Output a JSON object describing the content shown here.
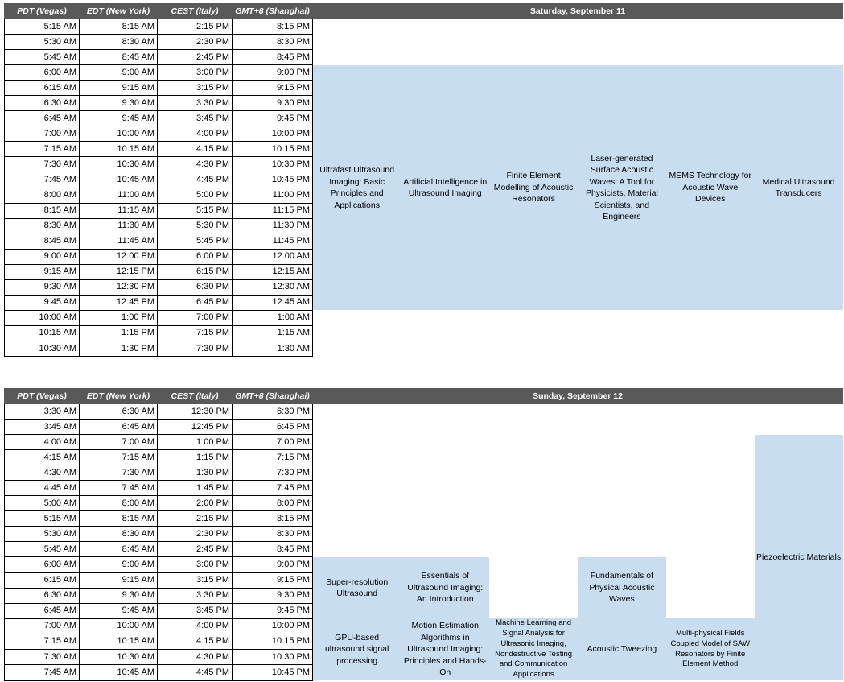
{
  "headers": [
    "PDT (Vegas)",
    "EDT (New York)",
    "CEST (Italy)",
    "GMT+8 (Shanghai)"
  ],
  "day1": {
    "title": "Saturday, September 11",
    "rows": [
      [
        "5:15 AM",
        "8:15 AM",
        "2:15 PM",
        "8:15 PM"
      ],
      [
        "5:30 AM",
        "8:30 AM",
        "2:30 PM",
        "8:30 PM"
      ],
      [
        "5:45 AM",
        "8:45 AM",
        "2:45 PM",
        "8:45 PM"
      ],
      [
        "6:00 AM",
        "9:00 AM",
        "3:00 PM",
        "9:00 PM"
      ],
      [
        "6:15 AM",
        "9:15 AM",
        "3:15 PM",
        "9:15 PM"
      ],
      [
        "6:30 AM",
        "9:30 AM",
        "3:30 PM",
        "9:30 PM"
      ],
      [
        "6:45 AM",
        "9:45 AM",
        "3:45 PM",
        "9:45 PM"
      ],
      [
        "7:00 AM",
        "10:00 AM",
        "4:00 PM",
        "10:00 PM"
      ],
      [
        "7:15 AM",
        "10:15 AM",
        "4:15 PM",
        "10:15 PM"
      ],
      [
        "7:30 AM",
        "10:30 AM",
        "4:30 PM",
        "10:30 PM"
      ],
      [
        "7:45 AM",
        "10:45 AM",
        "4:45 PM",
        "10:45 PM"
      ],
      [
        "8:00 AM",
        "11:00 AM",
        "5:00 PM",
        "11:00 PM"
      ],
      [
        "8:15 AM",
        "11:15 AM",
        "5:15 PM",
        "11:15 PM"
      ],
      [
        "8:30 AM",
        "11:30 AM",
        "5:30 PM",
        "11:30 PM"
      ],
      [
        "8:45 AM",
        "11:45 AM",
        "5:45 PM",
        "11:45 PM"
      ],
      [
        "9:00 AM",
        "12:00 PM",
        "6:00 PM",
        "12:00 AM"
      ],
      [
        "9:15 AM",
        "12:15 PM",
        "6:15 PM",
        "12:15 AM"
      ],
      [
        "9:30 AM",
        "12:30 PM",
        "6:30 PM",
        "12:30 AM"
      ],
      [
        "9:45 AM",
        "12:45 PM",
        "6:45 PM",
        "12:45 AM"
      ],
      [
        "10:00 AM",
        "1:00 PM",
        "7:00 PM",
        "1:00 AM"
      ],
      [
        "10:15 AM",
        "1:15 PM",
        "7:15 PM",
        "1:15 AM"
      ],
      [
        "10:30 AM",
        "1:30 PM",
        "7:30 PM",
        "1:30 AM"
      ]
    ],
    "sessions": [
      "Ultrafast Ultrasound Imaging: Basic Principles and Applications",
      "Artificial Intelligence in Ultrasound Imaging",
      "Finite Element Modelling of Acoustic Resonators",
      "Laser-generated Surface Acoustic Waves: A Tool for Physicists, Material Scientists, and Engineers",
      "MEMS Technology for Acoustic Wave Devices",
      "Medical Ultrasound Transducers"
    ]
  },
  "day2": {
    "title": "Sunday, September 12",
    "rows": [
      [
        "3:30 AM",
        "6:30 AM",
        "12:30 PM",
        "6:30 PM"
      ],
      [
        "3:45 AM",
        "6:45 AM",
        "12:45 PM",
        "6:45 PM"
      ],
      [
        "4:00 AM",
        "7:00 AM",
        "1:00 PM",
        "7:00 PM"
      ],
      [
        "4:15 AM",
        "7:15 AM",
        "1:15 PM",
        "7:15 PM"
      ],
      [
        "4:30 AM",
        "7:30 AM",
        "1:30 PM",
        "7:30 PM"
      ],
      [
        "4:45 AM",
        "7:45 AM",
        "1:45 PM",
        "7:45 PM"
      ],
      [
        "5:00 AM",
        "8:00 AM",
        "2:00 PM",
        "8:00 PM"
      ],
      [
        "5:15 AM",
        "8:15 AM",
        "2:15 PM",
        "8:15 PM"
      ],
      [
        "5:30 AM",
        "8:30 AM",
        "2:30 PM",
        "8:30 PM"
      ],
      [
        "5:45 AM",
        "8:45 AM",
        "2:45 PM",
        "8:45 PM"
      ],
      [
        "6:00 AM",
        "9:00 AM",
        "3:00 PM",
        "9:00 PM"
      ],
      [
        "6:15 AM",
        "9:15 AM",
        "3:15 PM",
        "9:15 PM"
      ],
      [
        "6:30 AM",
        "9:30 AM",
        "3:30 PM",
        "9:30 PM"
      ],
      [
        "6:45 AM",
        "9:45 AM",
        "3:45 PM",
        "9:45 PM"
      ],
      [
        "7:00 AM",
        "10:00 AM",
        "4:00 PM",
        "10:00 PM"
      ],
      [
        "7:15 AM",
        "10:15 AM",
        "4:15 PM",
        "10:15 PM"
      ],
      [
        "7:30 AM",
        "10:30 AM",
        "4:30 PM",
        "10:30 PM"
      ],
      [
        "7:45 AM",
        "10:45 AM",
        "4:45 PM",
        "10:45 PM"
      ]
    ],
    "sessions": {
      "super_resolution": "Super-resolution Ultrasound",
      "essentials": "Essentials of Ultrasound Imaging: An Introduction",
      "fundamentals": "Fundamentals of Physical Acoustic Waves",
      "piezoelectric": "Piezoelectric Materials",
      "gpu": "GPU-based ultrasound signal processing",
      "motion": "Motion Estimation Algorithms in Ultrasound Imaging: Principles and Hands-On",
      "machine_learning": "Machine Learning and Signal Analysis for Ultrasonic Imaging, Nondestructive Testing and Communication Applications",
      "tweezing": "Acoustic Tweezing",
      "multiphysical": "Multi-physical Fields Coupled Model of SAW Resonators by Finite Element Method"
    }
  },
  "colors": {
    "header_bg": "#595959",
    "session_bg": "#c9ddf0",
    "grid": "#000000"
  }
}
